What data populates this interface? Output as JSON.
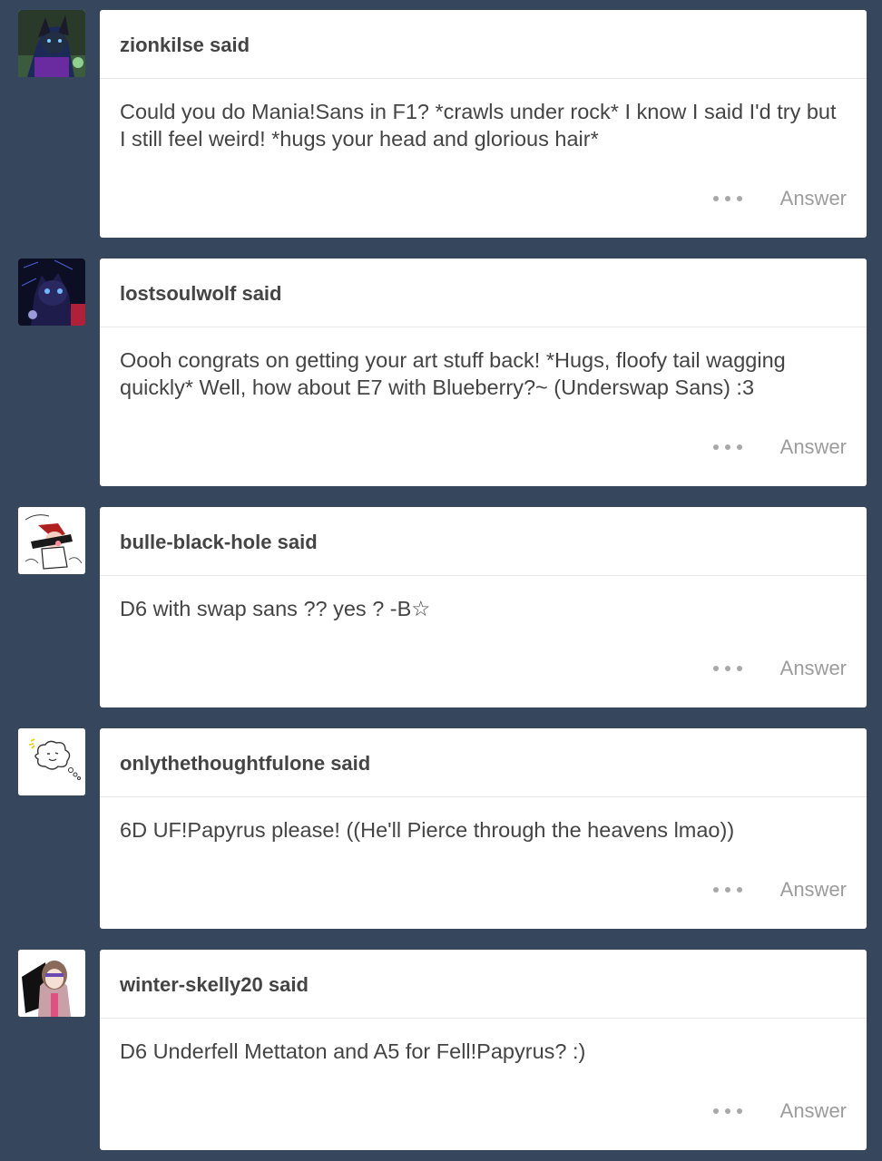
{
  "asks": [
    {
      "asker": "zionkilse",
      "said": "said",
      "question": "Could you do Mania!Sans in F1? *crawls under rock* I know I said I'd try but I still feel weird! *hugs your head and glorious hair*",
      "answer_label": "Answer",
      "avatar_icon": "wolf-avatar-icon"
    },
    {
      "asker": "lostsoulwolf",
      "said": "said",
      "question": "Oooh congrats on getting your art stuff back! *Hugs, floofy tail wagging quickly* Well, how about E7 with Blueberry?~ (Underswap Sans) :3",
      "answer_label": "Answer",
      "avatar_icon": "dark-wolf-avatar-icon"
    },
    {
      "asker": "bulle-black-hole",
      "said": "said",
      "question": "D6 with swap sans ?? yes ? -B☆",
      "answer_label": "Answer",
      "avatar_icon": "sketch-character-avatar-icon"
    },
    {
      "asker": "onlythethoughtfulone",
      "said": "said",
      "question": "6D UF!Papyrus please! ((He'll Pierce through the heavens lmao))",
      "answer_label": "Answer",
      "avatar_icon": "thought-cloud-avatar-icon"
    },
    {
      "asker": "winter-skelly20",
      "said": "said",
      "question": "D6 Underfell Mettaton and A5 for Fell!Papyrus? :)",
      "answer_label": "Answer",
      "avatar_icon": "hooded-character-avatar-icon"
    }
  ],
  "colors": {
    "background": "#36465d",
    "card": "#ffffff",
    "text": "#444444",
    "muted": "#9c9c9c"
  }
}
